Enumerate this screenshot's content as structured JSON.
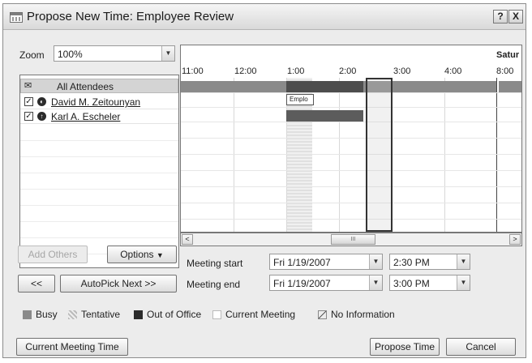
{
  "window": {
    "title": "Propose New Time:  Employee Review",
    "help_label": "?",
    "close_label": "X"
  },
  "zoom": {
    "label": "Zoom",
    "value": "100%"
  },
  "attendees": {
    "header": "All Attendees",
    "rows": [
      {
        "name": "David M. Zeitounyan",
        "checked": true
      },
      {
        "name": "Karl A. Escheler",
        "checked": true
      }
    ]
  },
  "grid": {
    "day_label": "Satur",
    "times": [
      "11:00",
      "12:00",
      "1:00",
      "2:00",
      "3:00",
      "4:00",
      "8:00"
    ],
    "busy_hint": "Emplo",
    "scroll_left": "<",
    "scroll_right": ">",
    "scroll_grip": "III"
  },
  "buttons": {
    "add_others": "Add Others",
    "options": "Options",
    "prev": "<<",
    "autopick_next": "AutoPick Next >>",
    "current_meeting_time": "Current Meeting Time",
    "propose_time": "Propose Time",
    "cancel": "Cancel"
  },
  "meeting": {
    "start_label": "Meeting start",
    "end_label": "Meeting end",
    "start_date": "Fri 1/19/2007",
    "start_time": "2:30 PM",
    "end_date": "Fri 1/19/2007",
    "end_time": "3:00 PM"
  },
  "legend": {
    "busy": "Busy",
    "tentative": "Tentative",
    "out_of_office": "Out of Office",
    "current_meeting": "Current Meeting",
    "no_information": "No Information"
  },
  "colors": {
    "busy": "#7a7a7a",
    "out_of_office": "#2b2b2b",
    "window_bg": "#ececec"
  }
}
